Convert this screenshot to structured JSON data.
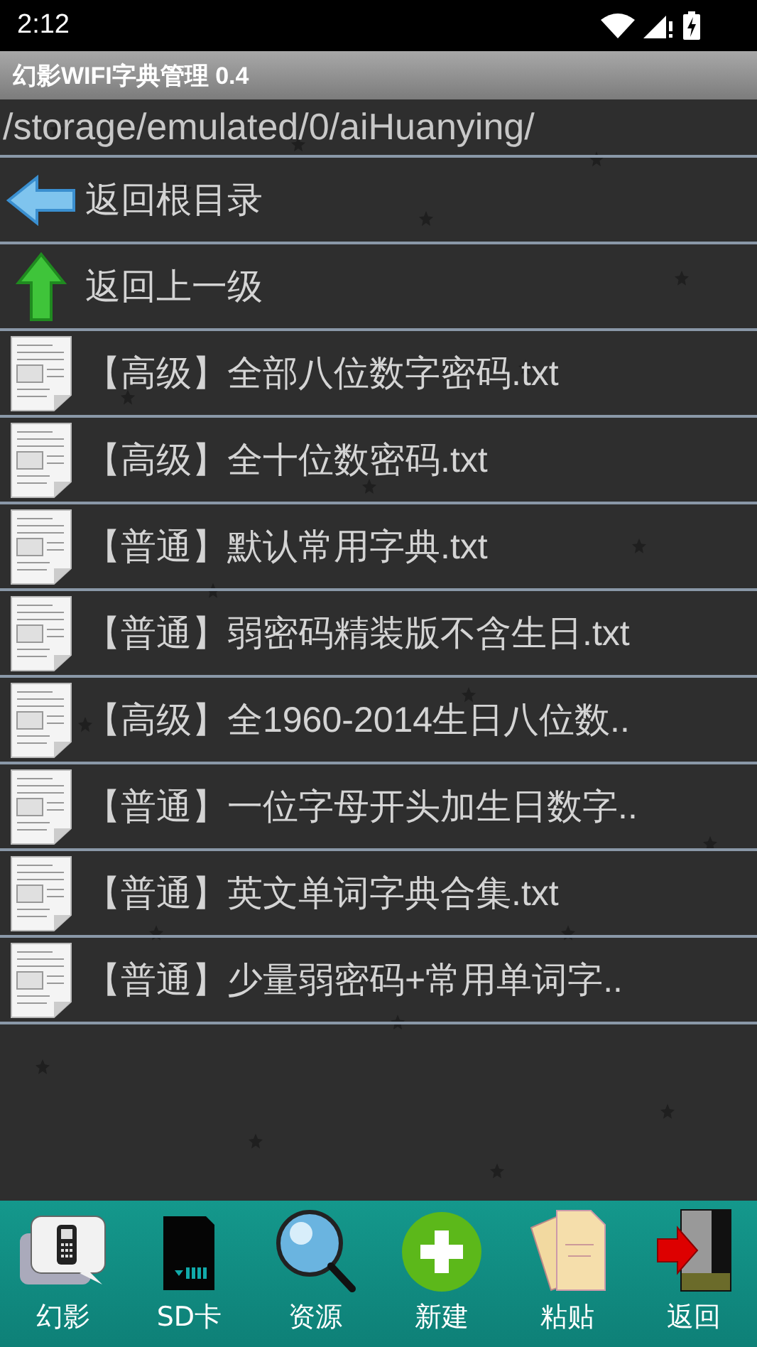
{
  "status_bar": {
    "time": "2:12"
  },
  "window": {
    "title": "幻影WIFI字典管理 0.4"
  },
  "path": "/storage/emulated/0/aiHuanying/",
  "rows": [
    {
      "kind": "root",
      "label": "返回根目录"
    },
    {
      "kind": "up",
      "label": "返回上一级"
    },
    {
      "kind": "file",
      "label": "【高级】全部八位数字密码.txt"
    },
    {
      "kind": "file",
      "label": "【高级】全十位数密码.txt"
    },
    {
      "kind": "file",
      "label": "【普通】默认常用字典.txt"
    },
    {
      "kind": "file",
      "label": "【普通】弱密码精装版不含生日.txt"
    },
    {
      "kind": "file",
      "label": "【高级】全1960-2014生日八位数.."
    },
    {
      "kind": "file",
      "label": "【普通】一位字母开头加生日数字.."
    },
    {
      "kind": "file",
      "label": "【普通】英文单词字典合集.txt"
    },
    {
      "kind": "file",
      "label": "【普通】少量弱密码+常用单词字.."
    }
  ],
  "toolbar": [
    {
      "kind": "phone",
      "label": "幻影"
    },
    {
      "kind": "sd",
      "label": "SD卡"
    },
    {
      "kind": "search",
      "label": "资源"
    },
    {
      "kind": "new",
      "label": "新建"
    },
    {
      "kind": "paste",
      "label": "粘贴"
    },
    {
      "kind": "exit",
      "label": "返回"
    }
  ]
}
